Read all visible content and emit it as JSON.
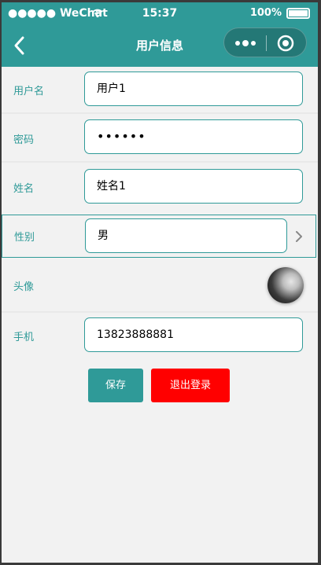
{
  "status_bar": {
    "carrier": "●●●●● WeChat",
    "time": "15:37",
    "battery": "100%"
  },
  "nav": {
    "title": "用户信息",
    "back_icon": "chevron-left-icon",
    "capsule_icons": [
      "more-dots-icon",
      "target-icon"
    ]
  },
  "form": {
    "username": {
      "label": "用户名",
      "value": "用户1"
    },
    "password": {
      "label": "密码",
      "value": "••••••"
    },
    "name": {
      "label": "姓名",
      "value": "姓名1"
    },
    "gender": {
      "label": "性别",
      "value": "男"
    },
    "avatar": {
      "label": "头像"
    },
    "phone": {
      "label": "手机",
      "value": "13823888881"
    }
  },
  "buttons": {
    "save": "保存",
    "logout": "退出登录"
  },
  "colors": {
    "accent": "#2f9a98",
    "danger": "#ff0000",
    "background": "#f2f2f2"
  }
}
